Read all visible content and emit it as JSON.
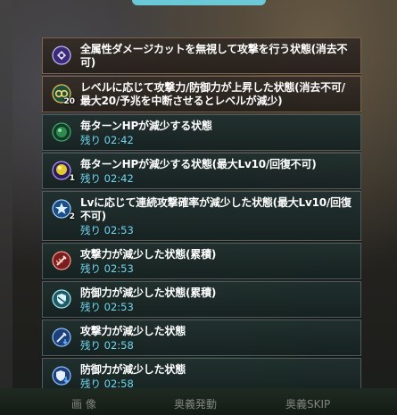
{
  "bottom_bar": {
    "left_hint": "画 像",
    "mid_hint": "奥義発動",
    "right_hint": "奥義SKIP"
  },
  "effects": [
    {
      "icon": "purple-sigil-icon",
      "description": "全属性ダメージカットを無視して攻撃を行う状態(消去不可)",
      "remaining": "",
      "sub": ""
    },
    {
      "icon": "gold-level-up-icon",
      "description": "レベルに応じて攻撃力/防御力が上昇した状態(消去不可/最大20/予兆を中断させるとレベルが減少)",
      "remaining": "",
      "sub": "20"
    },
    {
      "icon": "green-poison-orb-icon",
      "description": "毎ターンHPが減少する状態",
      "remaining": "残り 02:42",
      "sub": ""
    },
    {
      "icon": "yellow-poison-orb-icon",
      "description": "毎ターンHPが減少する状態(最大Lv10/回復不可)",
      "remaining": "残り 02:42",
      "sub": "1"
    },
    {
      "icon": "blue-multiattack-down-icon",
      "description": "Lvに応じて連続攻撃確率が減少した状態(最大Lv10/回復不可)",
      "remaining": "残り 02:53",
      "sub": "2"
    },
    {
      "icon": "red-sword-down-icon",
      "description": "攻撃力が減少した状態(累積)",
      "remaining": "残り 02:53",
      "sub": ""
    },
    {
      "icon": "teal-shield-down-icon",
      "description": "防御力が減少した状態(累積)",
      "remaining": "残り 02:53",
      "sub": ""
    },
    {
      "icon": "blue-sword-down-icon",
      "description": "攻撃力が減少した状態",
      "remaining": "残り 02:58",
      "sub": ""
    },
    {
      "icon": "blue-shield-down-icon",
      "description": "防御力が減少した状態",
      "remaining": "残り 02:58",
      "sub": ""
    }
  ]
}
